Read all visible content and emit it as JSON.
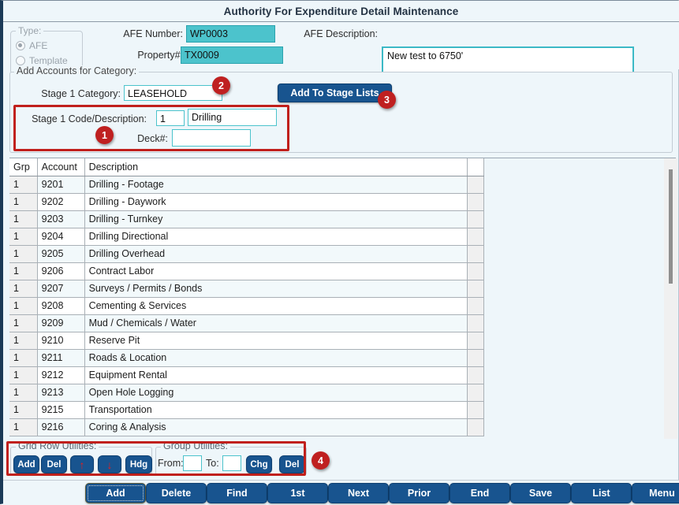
{
  "window": {
    "title": "Authority For Expenditure Detail Maintenance"
  },
  "type_group": {
    "legend": "Type:",
    "options": [
      {
        "label": "AFE",
        "selected": true
      },
      {
        "label": "Template",
        "selected": false
      }
    ]
  },
  "header_fields": {
    "afe_number_label": "AFE Number:",
    "afe_number_value": "WP0003",
    "property_label": "Property#:",
    "property_value": "TX0009",
    "afe_description_label": "AFE Description:",
    "afe_description_value": "New test to 6750'"
  },
  "category_panel": {
    "legend": "Add Accounts for Category:",
    "stage_category_label": "Stage 1 Category:",
    "stage_category_value": "LEASEHOLD",
    "add_to_stage_lists_label": "Add To Stage Lists",
    "stage_code_desc_label": "Stage 1 Code/Description:",
    "stage_code_value": "1",
    "stage_desc_value": "Drilling",
    "deck_label": "Deck#:",
    "deck_value": ""
  },
  "callouts": [
    {
      "number": "1"
    },
    {
      "number": "2"
    },
    {
      "number": "3"
    },
    {
      "number": "4"
    }
  ],
  "grid": {
    "columns": [
      "Grp",
      "Account",
      "Description"
    ],
    "rows": [
      {
        "grp": "1",
        "account": "9201",
        "description": "Drilling - Footage"
      },
      {
        "grp": "1",
        "account": "9202",
        "description": "Drilling - Daywork"
      },
      {
        "grp": "1",
        "account": "9203",
        "description": "Drilling - Turnkey"
      },
      {
        "grp": "1",
        "account": "9204",
        "description": "Drilling Directional"
      },
      {
        "grp": "1",
        "account": "9205",
        "description": "Drilling Overhead"
      },
      {
        "grp": "1",
        "account": "9206",
        "description": "Contract Labor"
      },
      {
        "grp": "1",
        "account": "9207",
        "description": "Surveys / Permits / Bonds"
      },
      {
        "grp": "1",
        "account": "9208",
        "description": "Cementing & Services"
      },
      {
        "grp": "1",
        "account": "9209",
        "description": "Mud / Chemicals / Water"
      },
      {
        "grp": "1",
        "account": "9210",
        "description": "Reserve Pit"
      },
      {
        "grp": "1",
        "account": "9211",
        "description": "Roads & Location"
      },
      {
        "grp": "1",
        "account": "9212",
        "description": "Equipment Rental"
      },
      {
        "grp": "1",
        "account": "9213",
        "description": "Open Hole Logging"
      },
      {
        "grp": "1",
        "account": "9215",
        "description": "Transportation"
      },
      {
        "grp": "1",
        "account": "9216",
        "description": "Coring & Analysis"
      }
    ]
  },
  "grid_row_utilities": {
    "legend": "Grid Row Utilities:",
    "add_label": "Add",
    "del_label": "Del",
    "move_up_icon": "arrow-up-icon",
    "move_down_icon": "arrow-down-icon",
    "hdg_label": "Hdg"
  },
  "group_utilities": {
    "legend": "Group Utilities:",
    "from_label": "From:",
    "from_value": "",
    "to_label": "To:",
    "to_value": "",
    "chg_label": "Chg",
    "del_label": "Del"
  },
  "navbar": {
    "buttons": [
      {
        "label": "Add"
      },
      {
        "label": "Delete"
      },
      {
        "label": "Find"
      },
      {
        "label": "1st"
      },
      {
        "label": "Next"
      },
      {
        "label": "Prior"
      },
      {
        "label": "End"
      },
      {
        "label": "Save"
      },
      {
        "label": "List"
      },
      {
        "label": "Menu"
      }
    ]
  },
  "colors": {
    "accent_blue": "#18548f",
    "teal_field": "#4cc3cc",
    "callout_red": "#bf2020",
    "panel_bg": "#eef6fa"
  }
}
